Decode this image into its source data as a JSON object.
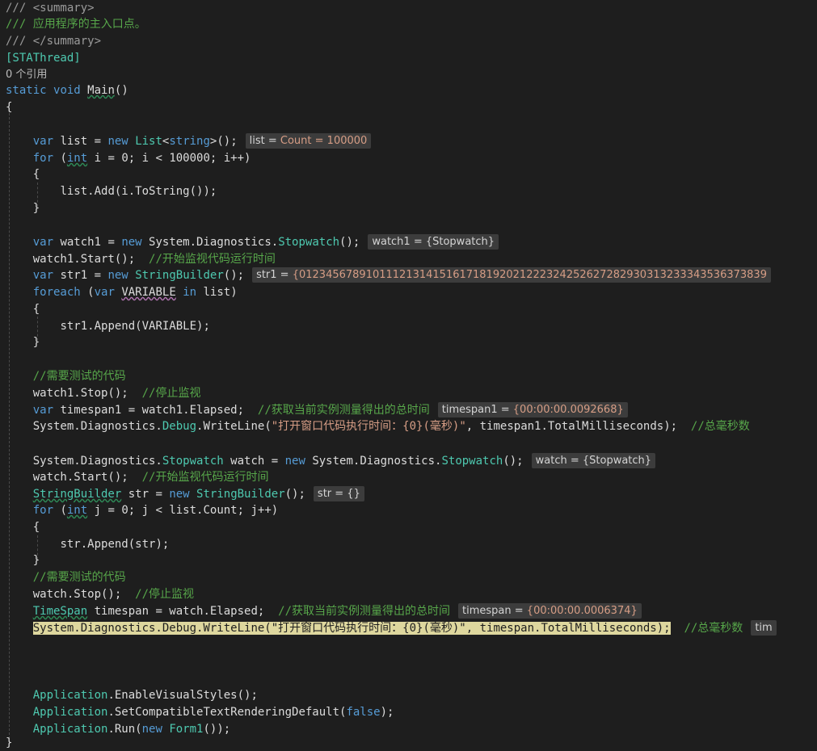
{
  "code": {
    "l1": "/// <summary>",
    "l2": "/// 应用程序的主入口点。",
    "l3": "/// </summary>",
    "l4": "[STAThread]",
    "l5_refs": "0 个引用",
    "l6_static": "static",
    "l6_void": "void",
    "l6_main": "Main",
    "l6_paren": "()",
    "l7": "{",
    "l9_var": "var",
    "l9_rest1": " list = ",
    "l9_new": "new",
    "l9_list": "List",
    "l9_lt": "<",
    "l9_string": "string",
    "l9_rest2": ">();",
    "l10_for": "for",
    "l10_p": " (",
    "l10_int": "int",
    "l10_rest": " i = 0; i < 100000; i++)",
    "l11": "{",
    "l12": "list.Add(i.ToString());",
    "l13": "}",
    "l15_var": "var",
    "l15_rest1": " watch1 = ",
    "l15_new": "new",
    "l15_sd": " System.Diagnostics.",
    "l15_sw": "Stopwatch",
    "l15_rest2": "();",
    "l16_code": "watch1.Start();",
    "l16_cmt": "//开始监视代码运行时间",
    "l17_var": "var",
    "l17_rest1": " str1 = ",
    "l17_new": "new",
    "l17_sb": "StringBuilder",
    "l17_rest2": "();",
    "l18_foreach": "foreach",
    "l18_p": " (",
    "l18_var": "var",
    "l18_VAR": "VARIABLE",
    "l18_in": "in",
    "l18_rest": " list)",
    "l19": "{",
    "l20": "str1.Append(VARIABLE);",
    "l21": "}",
    "l23_cmt": "//需要测试的代码",
    "l24_code": "watch1.Stop();",
    "l24_cmt": "//停止监视",
    "l25_var": "var",
    "l25_rest": " timespan1 = watch1.Elapsed;",
    "l25_cmt": "//获取当前实例测量得出的总时间",
    "l26_sd": "System.Diagnostics.",
    "l26_debug": "Debug",
    "l26_wl": ".WriteLine(",
    "l26_str": "\"打开窗口代码执行时间：{0}(毫秒)\"",
    "l26_rest": ", timespan1.TotalMilliseconds);",
    "l26_cmt": "//总毫秒数",
    "l28_sd": "System.Diagnostics.",
    "l28_sw": "Stopwatch",
    "l28_rest1": " watch = ",
    "l28_new": "new",
    "l28_sd2": " System.Diagnostics.",
    "l28_sw2": "Stopwatch",
    "l28_rest2": "();",
    "l29_code": "watch.Start();",
    "l29_cmt": "//开始监视代码运行时间",
    "l30_sb": "StringBuilder",
    "l30_rest1": " str = ",
    "l30_new": "new",
    "l30_sb2": "StringBuilder",
    "l30_rest2": "();",
    "l31_for": "for",
    "l31_p": " (",
    "l31_int": "int",
    "l31_rest": " j = 0; j < list.Count; j++)",
    "l32": "{",
    "l33": "str.Append(str);",
    "l34": "}",
    "l35_cmt": "//需要测试的代码",
    "l36_code": "watch.Stop();",
    "l36_cmt": "//停止监视",
    "l37_ts": "TimeSpan",
    "l37_rest": " timespan = watch.Elapsed;",
    "l37_cmt": "//获取当前实例测量得出的总时间",
    "l38_code": "System.Diagnostics.Debug.WriteLine(\"打开窗口代码执行时间：{0}(毫秒)\", timespan.TotalMilliseconds);",
    "l38_cmt": "//总毫秒数",
    "l42_app": "Application",
    "l42_rest": ".EnableVisualStyles();",
    "l43_app": "Application",
    "l43_rest1": ".SetCompatibleTextRenderingDefault(",
    "l43_false": "false",
    "l43_rest2": ");",
    "l44_app": "Application",
    "l44_rest1": ".Run(",
    "l44_new": "new",
    "l44_form": "Form1",
    "l44_rest2": "());",
    "l45": "}"
  },
  "hints": {
    "list_name": "list = ",
    "list_val": "Count = 100000",
    "watch1": "watch1 = {Stopwatch}",
    "str1_name": "str1 = ",
    "str1_val": "{0123456789101112131415161718192021222324252627282930313233343536373839",
    "timespan1_name": "timespan1 = ",
    "timespan1_val": "{00:00:00.0092668}",
    "watch": "watch = {Stopwatch}",
    "str": "str = {}",
    "timespan_name": "timespan = ",
    "timespan_val": "{00:00:00.0006374}",
    "tim_trunc": "tim"
  }
}
